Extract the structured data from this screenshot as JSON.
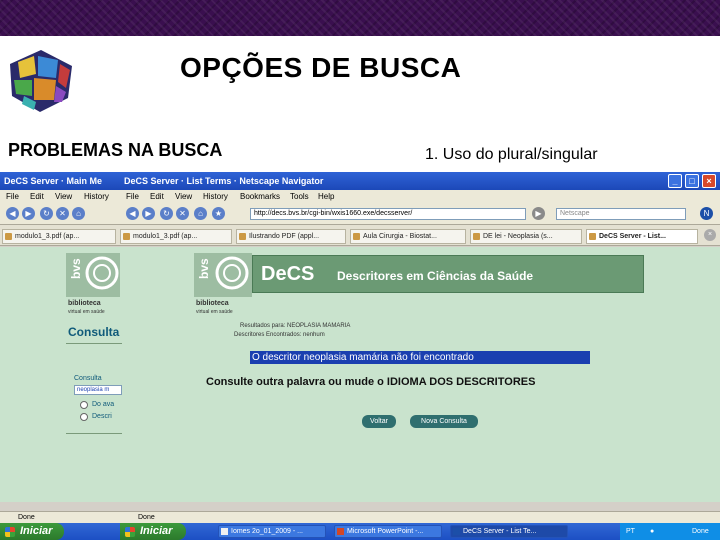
{
  "slide": {
    "title": "OPÇÕES DE BUSCA",
    "left_heading": "PROBLEMAS NA BUSCA",
    "right_heading": "1. Uso do plural/singular"
  },
  "browser": {
    "window_title_left": "DeCS Server · Main Me",
    "window_title_right": "DeCS Server · List Terms · Netscape Navigator",
    "window_buttons": [
      "minimize-icon",
      "maximize-icon",
      "close-icon"
    ],
    "menu_left": [
      "File",
      "Edit",
      "View",
      "History"
    ],
    "menu_right": [
      "File",
      "Edit",
      "View",
      "History",
      "Bookmarks",
      "Tools",
      "Help"
    ],
    "url": "http://decs.bvs.br/cgi-bin/wxis1660.exe/decsserver/",
    "search_placeholder": "Netscape",
    "tabs": [
      "modulo1_3.pdf (ap...",
      "modulo1_3.pdf (ap...",
      "Ilustrando PDF (appl...",
      "Aula Cirurgia - Biostat...",
      "DE lei - Neoplasia (s...",
      "DeCS Server - List..."
    ]
  },
  "page": {
    "bvs_label": "biblioteca",
    "bvs_sub": "virtual em saúde",
    "decs_logo": "DeCS",
    "decs_tagline": "Descritores em Ciências da Saúde",
    "consult_label": "Consulta",
    "result_line1": "Resultados para: NEOPLASIA MAMARIA",
    "result_line2": "Descritores Encontrados: nenhum",
    "not_found_message": "O descritor neoplasia mamária não foi encontrado",
    "suggestion": "Consulte outra palavra ou mude o IDIOMA DOS DESCRITORES",
    "back_button": "Voltar",
    "new_search_button": "Nova Consulta",
    "left_form_label": "Consulta",
    "left_input_value": "neoplasia m",
    "left_radio_1": "Do ava",
    "left_radio_2": "Descri"
  },
  "status": {
    "left": "Done",
    "right": "Done"
  },
  "taskbar": {
    "start_label": "Iniciar",
    "tasks": [
      "Iniciar",
      "Iomes 2o_01_2009 - ...",
      "Microsoft PowerPoint -...",
      "DeCS Server - List Te..."
    ],
    "tray_text": "PT",
    "tray_clock": "Done"
  },
  "colors": {
    "banner": "#3a0f4f",
    "titlebar": "#2f63d6",
    "page_background": "#c9e3cd",
    "decs_banner": "#6b9a74",
    "highlight": "#1a3fb0"
  }
}
